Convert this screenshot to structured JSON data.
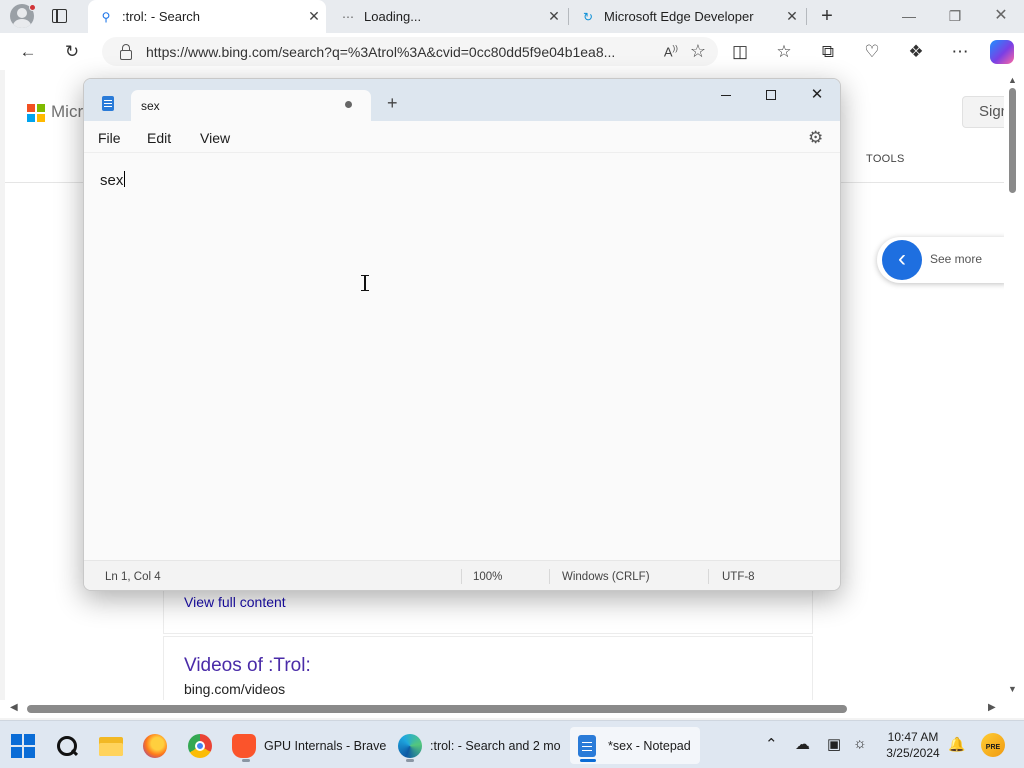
{
  "browser": {
    "tabs": [
      {
        "title": ":trol: - Search",
        "active": true
      },
      {
        "title": "Loading...",
        "active": false
      },
      {
        "title": "Microsoft Edge Developer",
        "active": false
      }
    ],
    "url": "https://www.bing.com/search?q=%3Atrol%3A&cvid=0cc80dd5f9e04b1ea8...",
    "read_aloud_label": "A",
    "icons": [
      "profile-icon",
      "tab-actions-icon",
      "search-icon",
      "loading-icon",
      "edge-dev-icon",
      "new-tab-icon",
      "minimize-icon",
      "restore-icon",
      "close-icon",
      "back-icon",
      "refresh-icon",
      "lock-icon",
      "favorite-star-icon",
      "split-screen-icon",
      "favorites-icon",
      "collections-icon",
      "performance-icon",
      "extensions-icon",
      "more-icon",
      "copilot-icon"
    ]
  },
  "page": {
    "logo_text": "Micro",
    "signin_label": "Sign",
    "tools_label": "TOOLS",
    "see_more_label": "See more",
    "view_full_content": "View full content",
    "videos_title": "Videos of :Trol:",
    "videos_url": "bing.com/videos"
  },
  "notepad": {
    "tab_title": "sex",
    "unsaved": true,
    "menu": [
      "File",
      "Edit",
      "View"
    ],
    "content": "sex",
    "status": {
      "position": "Ln 1, Col 4",
      "zoom": "100%",
      "line_endings": "Windows (CRLF)",
      "encoding": "UTF-8"
    }
  },
  "taskbar": {
    "apps": [
      {
        "name": "GPU Internals - Brave"
      },
      {
        "name": ":trol: - Search and 2 mo"
      },
      {
        "name": "*sex - Notepad"
      }
    ],
    "time": "10:47 AM",
    "date": "3/25/2024",
    "pre_badge": "PRE"
  },
  "colors": {
    "accent": "#0a6cd6",
    "taskbar_bg": "#dfe7f1",
    "notepad_title_bg": "#dde6ef",
    "link": "#1a0dab",
    "visited_link": "#4a2ba8"
  }
}
